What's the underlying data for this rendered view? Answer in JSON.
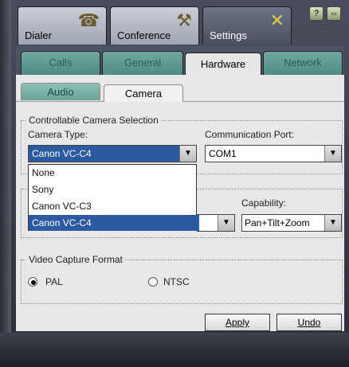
{
  "top_tabs": [
    {
      "label": "Dialer",
      "icon": "phone-icon"
    },
    {
      "label": "Conference",
      "icon": "gavel-icon"
    },
    {
      "label": "Settings",
      "icon": "tools-icon"
    }
  ],
  "top_buttons": [
    {
      "label": "?",
      "icon": "help-icon"
    },
    {
      "label": "⇔",
      "icon": "exit-icon"
    }
  ],
  "settings_tabs": [
    "Calls",
    "General",
    "Hardware",
    "Network"
  ],
  "hardware_tabs": [
    "Audio",
    "Camera"
  ],
  "camera_selection": {
    "title": "Controllable Camera Selection",
    "camera_type_label": "Camera Type:",
    "camera_type_value": "Canon VC-C4",
    "port_label": "Communication Port:",
    "port_value": "COM1",
    "options": [
      "None",
      "Sony",
      "Canon VC-C3",
      "Canon VC-C4"
    ]
  },
  "capability": {
    "label": "Capability:",
    "value": "Pan+Tilt+Zoom"
  },
  "video_capture": {
    "title": "Video Capture Format",
    "pal_label": "PAL",
    "ntsc_label": "NTSC",
    "selected": "PAL"
  },
  "buttons": {
    "apply": "Apply",
    "undo": "Undo"
  }
}
